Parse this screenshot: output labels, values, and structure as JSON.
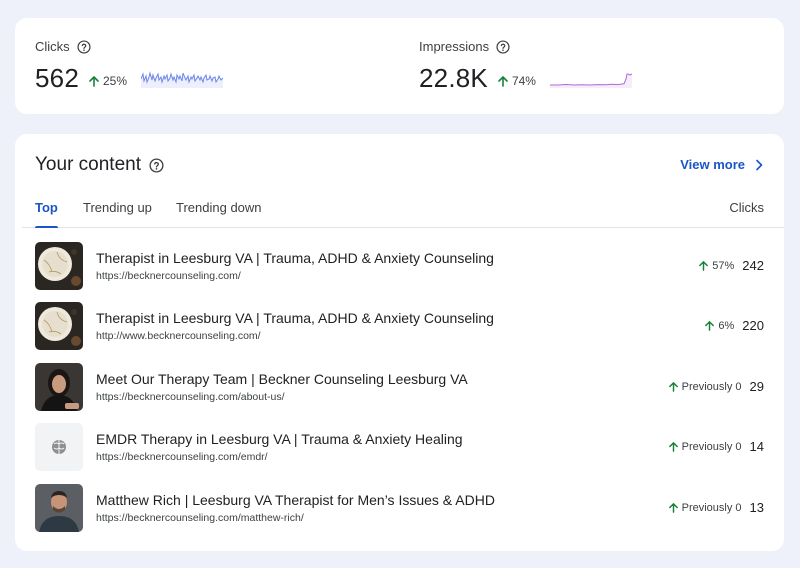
{
  "metrics": {
    "clicks": {
      "label": "Clicks",
      "value": "562",
      "change": "25%",
      "direction": "up",
      "sparkline_color": "#6e87e8"
    },
    "impressions": {
      "label": "Impressions",
      "value": "22.8K",
      "change": "74%",
      "direction": "up",
      "sparkline_color": "#b06ad6"
    }
  },
  "content": {
    "title": "Your content",
    "view_more": "View more",
    "tabs": [
      {
        "label": "Top",
        "active": true
      },
      {
        "label": "Trending up",
        "active": false
      },
      {
        "label": "Trending down",
        "active": false
      }
    ],
    "column_header": "Clicks",
    "rows": [
      {
        "title": "Therapist in Leesburg VA | Trauma, ADHD & Anxiety Counseling",
        "url": "https://becknercounseling.com/",
        "change": "57%",
        "clicks": "242",
        "thumbnail": "ceramic-plate-image"
      },
      {
        "title": "Therapist in Leesburg VA | Trauma, ADHD & Anxiety Counseling",
        "url": "http://www.becknercounseling.com/",
        "change": "6%",
        "clicks": "220",
        "thumbnail": "ceramic-plate-image"
      },
      {
        "title": "Meet Our Therapy Team | Beckner Counseling Leesburg VA",
        "url": "https://becknercounseling.com/about-us/",
        "change": "Previously 0",
        "clicks": "29",
        "thumbnail": "team-member-portrait"
      },
      {
        "title": "EMDR Therapy in Leesburg VA | Trauma & Anxiety Healing",
        "url": "https://becknercounseling.com/emdr/",
        "change": "Previously 0",
        "clicks": "14",
        "thumbnail": "brain-icon-placeholder"
      },
      {
        "title": "Matthew Rich | Leesburg VA Therapist for Men’s Issues & ADHD",
        "url": "https://becknercounseling.com/matthew-rich/",
        "change": "Previously 0",
        "clicks": "13",
        "thumbnail": "man-portrait"
      }
    ],
    "change_color": "#188038",
    "accent_color": "#1a56c8"
  }
}
